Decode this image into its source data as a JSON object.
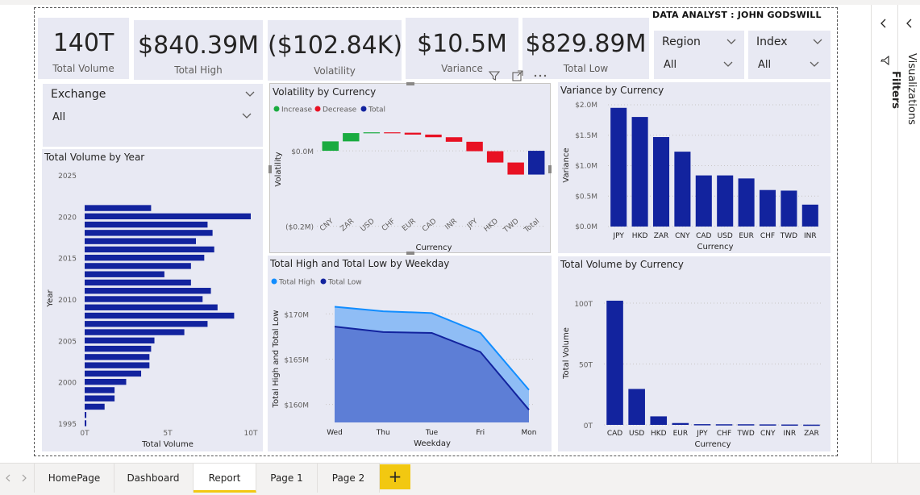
{
  "analyst_label": "DATA ANALYST : JOHN GODSWILL",
  "kpis": [
    {
      "value": "140T",
      "label": "Total Volume"
    },
    {
      "value": "$840.39M",
      "label": "Total High"
    },
    {
      "value": "($102.84K)",
      "label": "Volatility"
    },
    {
      "value": "$10.5M",
      "label": "Variance"
    },
    {
      "value": "$829.89M",
      "label": "Total Low"
    }
  ],
  "slicers": {
    "region": {
      "title": "Region",
      "value": "All"
    },
    "index": {
      "title": "Index",
      "value": "All"
    },
    "exchange": {
      "title": "Exchange",
      "value": "All"
    }
  },
  "right_pane": {
    "filters": "Filters",
    "visualizations": "Visualizations"
  },
  "tabs": [
    "HomePage",
    "Dashboard",
    "Report",
    "Page 1",
    "Page 2"
  ],
  "active_tab": "Report",
  "add_tab": "+",
  "colors": {
    "navy": "#12239e",
    "increase": "#1aab40",
    "decrease": "#e81123",
    "total": "#12239e",
    "area_high": "#118dff",
    "area_low": "#12239e",
    "card_bg": "#e8e9f3",
    "accent_tab": "#f2c811"
  },
  "chart_data": [
    {
      "type": "bar",
      "orientation": "horizontal",
      "title": "Total Volume by Year",
      "xlabel": "Total Volume",
      "ylabel": "Year",
      "x_ticks": [
        "0T",
        "5T",
        "10T"
      ],
      "y_ticks": [
        "2025",
        "2020",
        "2015",
        "2010",
        "2005",
        "2000",
        "1995"
      ],
      "xlim": [
        0,
        10
      ],
      "categories": [
        2021,
        2020,
        2019,
        2018,
        2017,
        2016,
        2015,
        2014,
        2013,
        2012,
        2011,
        2010,
        2009,
        2008,
        2007,
        2006,
        2005,
        2004,
        2003,
        2002,
        2001,
        2000,
        1999,
        1998,
        1997,
        1996,
        1995
      ],
      "values": [
        4.0,
        10.0,
        7.4,
        7.7,
        6.7,
        7.8,
        7.2,
        6.4,
        4.8,
        6.4,
        7.6,
        7.1,
        8.0,
        9.0,
        7.4,
        6.0,
        4.2,
        4.0,
        3.9,
        3.9,
        3.4,
        2.5,
        1.8,
        1.8,
        1.2,
        0.1,
        0.1
      ]
    },
    {
      "type": "waterfall",
      "title": "Volatility by Currency",
      "xlabel": "Currency",
      "ylabel": "Volatility",
      "y_ticks": [
        "$0.0M",
        "($0.2M)"
      ],
      "legend": [
        "Increase",
        "Decrease",
        "Total"
      ],
      "categories": [
        "CNY",
        "ZAR",
        "USD",
        "CHF",
        "EUR",
        "CAD",
        "INR",
        "JPY",
        "HKD",
        "TWD",
        "Total"
      ],
      "values": [
        0.025,
        0.022,
        0.002,
        -0.001,
        -0.005,
        -0.007,
        -0.012,
        -0.025,
        -0.03,
        -0.032,
        -0.063
      ],
      "kinds": [
        "increase",
        "increase",
        "increase",
        "decrease",
        "decrease",
        "decrease",
        "decrease",
        "decrease",
        "decrease",
        "decrease",
        "total"
      ],
      "ylim": [
        -0.22,
        0.06
      ]
    },
    {
      "type": "bar",
      "title": "Variance by Currency",
      "xlabel": "Currency",
      "ylabel": "Variance",
      "y_ticks": [
        "$2.0M",
        "$1.5M",
        "$1.0M",
        "$0.5M",
        "$0.0M"
      ],
      "ylim": [
        0,
        2.0
      ],
      "categories": [
        "JPY",
        "HKD",
        "ZAR",
        "CNY",
        "CAD",
        "USD",
        "EUR",
        "CHF",
        "TWD",
        "INR"
      ],
      "values": [
        1.95,
        1.8,
        1.47,
        1.23,
        0.84,
        0.84,
        0.79,
        0.6,
        0.59,
        0.36
      ]
    },
    {
      "type": "area",
      "title": "Total High and Total Low by Weekday",
      "xlabel": "Weekday",
      "ylabel": "Total High and Total Low",
      "y_ticks": [
        "$170M",
        "$165M",
        "$160M"
      ],
      "ylim": [
        158,
        172
      ],
      "categories": [
        "Wed",
        "Thu",
        "Tue",
        "Fri",
        "Mon"
      ],
      "series": [
        {
          "name": "Total High",
          "values": [
            170.8,
            170.3,
            170.1,
            167.9,
            161.6
          ]
        },
        {
          "name": "Total Low",
          "values": [
            168.6,
            168.0,
            167.9,
            165.8,
            159.4
          ]
        }
      ]
    },
    {
      "type": "bar",
      "title": "Total Volume by Currency",
      "xlabel": "Currency",
      "ylabel": "Total Volume",
      "y_ticks": [
        "100T",
        "50T",
        "0T"
      ],
      "ylim": [
        0,
        100
      ],
      "categories": [
        "CAD",
        "USD",
        "HKD",
        "EUR",
        "JPY",
        "CHF",
        "TWD",
        "CNY",
        "INR",
        "ZAR"
      ],
      "values": [
        102,
        29.5,
        7,
        1.5,
        0.6,
        0.5,
        0.5,
        0.4,
        0.3,
        0.2
      ]
    }
  ]
}
